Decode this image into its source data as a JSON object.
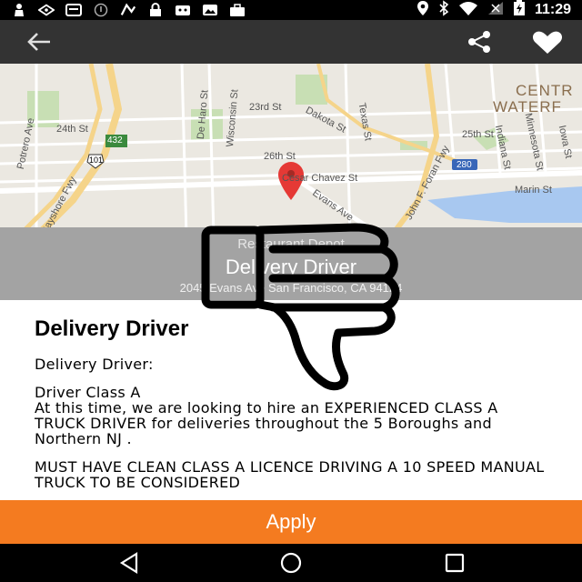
{
  "status_bar": {
    "time": "11:29",
    "left_icons": [
      "person-icon",
      "location-icon",
      "image-icon",
      "info-icon",
      "app-icon",
      "lock-icon",
      "robot-icon",
      "photo-icon",
      "bag-icon"
    ],
    "right_icons": [
      "location-pin-icon",
      "bluetooth-icon",
      "wifi-icon",
      "signal-icon",
      "battery-icon"
    ]
  },
  "app_bar": {
    "back_icon": "back-arrow-icon",
    "share_icon": "share-icon",
    "favorite_icon": "heart-icon"
  },
  "map": {
    "labels": {
      "street_23rd": "23rd St",
      "street_24th": "24th St",
      "street_25th": "25th St",
      "street_26th": "26th St",
      "cesar_chavez": "Cesar Chavez St",
      "marin": "Marin St",
      "evans": "Evans Ave",
      "bayshore": "Bayshore Fwy",
      "john_f_foran": "John F. Foran Fwy",
      "dakota": "Dakota St",
      "texas": "Texas St",
      "delaro": "De Haro St",
      "potrero": "Potrero Ave",
      "wisconsin": "Wisconsin St",
      "indiana": "Indiana St",
      "minnesota": "Minnesota St",
      "iowa": "Iowa St",
      "central": "CENTR",
      "waterfront": "WATERF"
    },
    "shields": {
      "hwy_101": "101",
      "hwy_432": "432",
      "hwy_280": "280"
    }
  },
  "job_header": {
    "company": "Restaurant Depot",
    "title": "Delivery Driver",
    "address": "2045 Evans Ave San Francisco, CA 94124"
  },
  "description": {
    "heading": "Delivery Driver",
    "p1": "Delivery Driver:",
    "p2_line1": "Driver Class A",
    "p2_line2": "At this time, we are looking to hire an EXPERIENCED CLASS A TRUCK DRIVER for deliveries throughout the 5 Boroughs and Northern NJ .",
    "p3": "MUST HAVE CLEAN CLASS A LICENCE DRIVING A 10 SPEED MANUAL TRUCK TO BE CONSIDERED"
  },
  "apply_button": {
    "label": "Apply"
  },
  "nav_bar": {
    "back": "nav-back-icon",
    "home": "nav-home-icon",
    "recents": "nav-recents-icon"
  },
  "overlay": {
    "icon": "thumbs-down-icon"
  },
  "colors": {
    "status_bar": "#000000",
    "app_bar": "#333333",
    "info_band": "#a3a3a3",
    "apply": "#f47b20",
    "nav_bar": "#000000",
    "map_pin": "#e53935"
  }
}
